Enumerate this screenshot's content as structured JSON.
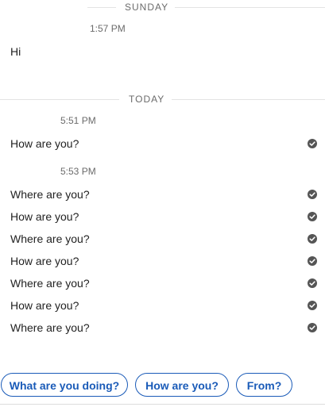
{
  "dividers": {
    "sunday": "SUNDAY",
    "today": "TODAY"
  },
  "groups": [
    {
      "time": "1:57 PM",
      "messages": [
        {
          "text": "Hi",
          "status": "none"
        }
      ]
    },
    {
      "time": "5:51 PM",
      "messages": [
        {
          "text": "How are you?",
          "status": "sent-check-icon"
        }
      ]
    },
    {
      "time": "5:53 PM",
      "messages": [
        {
          "text": "Where are you?",
          "status": "sent-check-icon"
        },
        {
          "text": "How are you?",
          "status": "sent-check-icon"
        },
        {
          "text": "Where are you?",
          "status": "sent-check-icon"
        },
        {
          "text": "How are you?",
          "status": "sent-check-icon"
        },
        {
          "text": "Where are you?",
          "status": "sent-check-icon"
        },
        {
          "text": "How are you?",
          "status": "sent-check-icon"
        },
        {
          "text": "Where are you?",
          "status": "sent-check-icon"
        }
      ]
    }
  ],
  "suggestions": [
    "What are you doing?",
    "How are you?",
    "From?"
  ],
  "colors": {
    "accent": "#1a5bb8",
    "check": "#555555",
    "divider_text": "#6b6b6b"
  }
}
